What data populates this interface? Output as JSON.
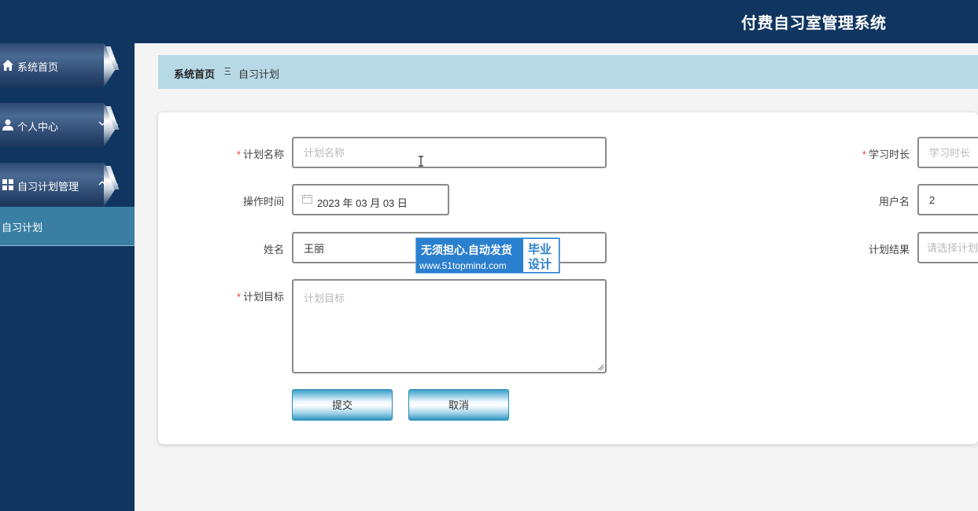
{
  "header": {
    "title": "付费自习室管理系统"
  },
  "sidebar": {
    "items": [
      {
        "label": "系统首页",
        "icon": "home-icon"
      },
      {
        "label": "个人中心",
        "icon": "user-icon",
        "chevron": "chevron-down-icon"
      },
      {
        "label": "自习计划管理",
        "icon": "grid-icon",
        "chevron": "chevron-up-icon"
      }
    ],
    "sub_item": {
      "label": "自习计划"
    }
  },
  "breadcrumb": {
    "home": "系统首页",
    "separator": "Ξ",
    "current": "自习计划"
  },
  "form": {
    "plan_name": {
      "label": "计划名称",
      "required": true,
      "placeholder": "计划名称",
      "value": ""
    },
    "study_duration": {
      "label": "学习时长",
      "required": true,
      "placeholder": "学习时长",
      "value": ""
    },
    "operation_time": {
      "label": "操作时间",
      "value": "2023 年 03 月 03 日"
    },
    "username": {
      "label": "用户名",
      "value": "2"
    },
    "name": {
      "label": "姓名",
      "value": "王丽"
    },
    "plan_result": {
      "label": "计划结果",
      "placeholder": "请选择计划结果",
      "value": ""
    },
    "plan_goal": {
      "label": "计划目标",
      "required": true,
      "placeholder": "计划目标",
      "value": ""
    },
    "submit_label": "提交",
    "cancel_label": "取消"
  },
  "watermark": {
    "line1": "无须担心.自动发货",
    "line2": "www.51topmind.com",
    "badge_line1": "毕业",
    "badge_line2": "设计"
  },
  "colors": {
    "header_bg": "#0f3560",
    "sub_item_bg": "#3a7fa3",
    "breadcrumb_bg": "#b7d9e6",
    "required": "#e4393c",
    "button_accent": "#2f95c0"
  }
}
